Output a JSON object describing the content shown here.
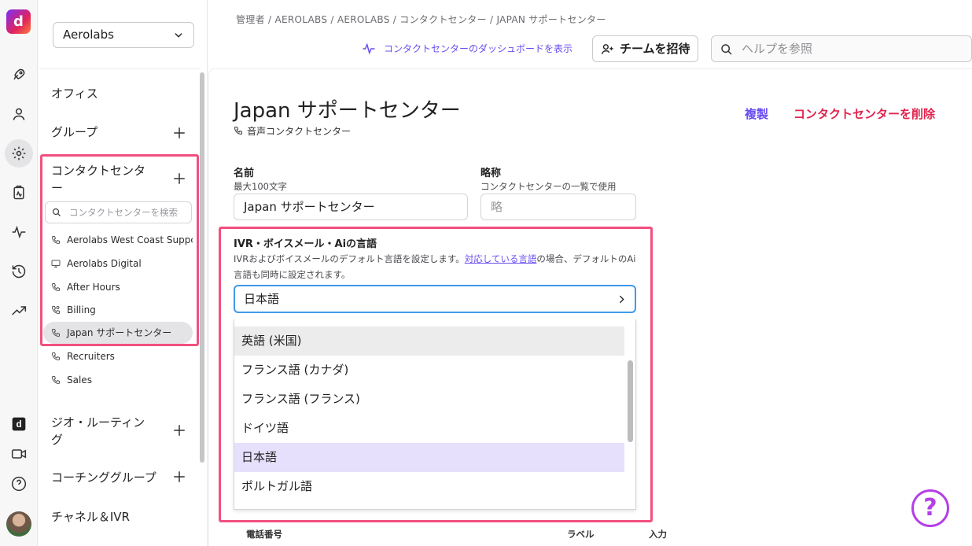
{
  "breadcrumb": "管理者 / AEROLABS / AEROLABS / コンタクトセンター / JAPAN サポートセンター",
  "header": {
    "dashboard_link": "コンタクトセンターのダッシュボードを表示",
    "invite_button": "チームを招待",
    "help_search_placeholder": "ヘルプを参照"
  },
  "rail": {
    "logo": "d",
    "icons": [
      "rocket-icon",
      "person-icon",
      "gear-icon",
      "clipboard-icon",
      "activity-icon",
      "history-icon",
      "trending-icon",
      "dialpad-icon",
      "video-icon",
      "help-icon"
    ],
    "active": "gear-icon"
  },
  "sidebar": {
    "org": "Aerolabs",
    "sections": {
      "office": "オフィス",
      "groups": "グループ",
      "contact_center_line1": "コンタクトセンタ",
      "contact_center_line2": "ー",
      "geo_line1": "ジオ・ルーティン",
      "geo_line2": "グ",
      "coaching": "コーチンググループ",
      "channels": "チャネル＆IVR"
    },
    "cc_search_placeholder": "コンタクトセンターを検索",
    "cc_items": [
      {
        "label": "Aerolabs West Coast Support",
        "icon": "phone-icon"
      },
      {
        "label": "Aerolabs Digital",
        "icon": "monitor-icon"
      },
      {
        "label": "After Hours",
        "icon": "phone-icon"
      },
      {
        "label": "Billing",
        "icon": "phone-alt-icon"
      },
      {
        "label": "Japan サポートセンター",
        "icon": "phone-icon",
        "active": true
      },
      {
        "label": "Recruiters",
        "icon": "phone-icon"
      },
      {
        "label": "Sales",
        "icon": "phone-icon"
      }
    ]
  },
  "main": {
    "title": "Japan サポートセンター",
    "subtitle": "音声コンタクトセンター",
    "duplicate": "複製",
    "delete": "コンタクトセンターを削除",
    "name_label": "名前",
    "name_hint": "最大100文字",
    "name_value": "Japan サポートセンター",
    "abbr_label": "略称",
    "abbr_hint": "コンタクトセンターの一覧で使用",
    "abbr_placeholder": "略",
    "lang_title": "IVR・ボイスメール・Aiの言語",
    "lang_desc_1": "IVRおよびボイスメールのデフォルト言語を設定します。",
    "lang_desc_link": "対応している言語",
    "lang_desc_2": "の場合、デフォルトのAi言語も同時に設定されます。",
    "lang_selected": "日本語",
    "lang_options": [
      "英語 (米国)",
      "フランス語 (カナダ)",
      "フランス語 (フランス)",
      "ドイツ語",
      "日本語",
      "ポルトガル語"
    ],
    "table_cols": [
      "電話番号",
      "ラベル",
      "入力"
    ]
  },
  "help_fab": "?",
  "colors": {
    "accent": "#6a4cf2",
    "danger": "#e0244e",
    "highlight": "#f2507f",
    "focus": "#3d9ae8"
  }
}
